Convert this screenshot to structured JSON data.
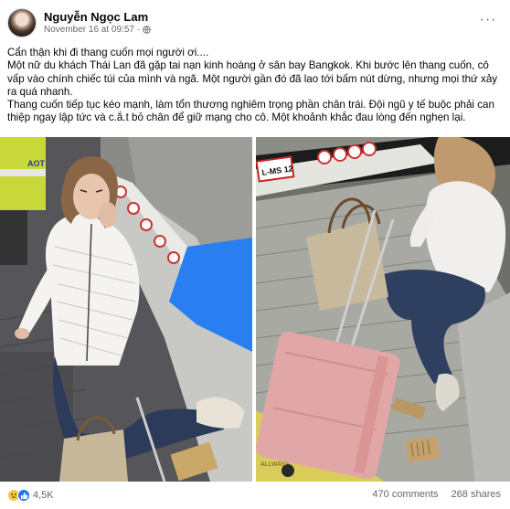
{
  "post": {
    "author": "Nguyễn Ngọc Lam",
    "date": "November 16 at 09:57",
    "separator": "·",
    "privacy_icon": "globe-icon",
    "more_label": "···",
    "text": {
      "line1": "Cẩn thận khi đi thang cuốn mọi người ơi....",
      "para2": "Một nữ du khách Thái Lan đã gặp tai nạn kinh hoàng ở sân bay Bangkok. Khi bước lên thang cuốn, cô vấp vào chính chiếc túi của mình và ngã. Một người gần đó đã lao tới bấm nút dừng, nhưng mọi thứ xảy ra quá nhanh.",
      "para3": "Thang cuốn tiếp tục kéo mạnh, làm tổn thương nghiêm trọng phần chân trái. Đội ngũ y tế buộc phải can thiệp ngay lập tức và c.ắ.t bỏ chân để giữ mạng cho cô. Một khoảnh khắc đau lòng đến nghẹn lại."
    },
    "photo_sign_text": "L-MS 12",
    "photo_vest_text": "AOT",
    "photo_trolley_text": "ALLWAYS",
    "reactions": {
      "icons": [
        "sad-react-icon",
        "like-react-icon"
      ],
      "count": "4,5K"
    },
    "comments": "470 comments",
    "shares": "268 shares"
  },
  "colors": {
    "secondary_text": "#65676b",
    "like_blue": "#1877f2",
    "sad_yellow": "#f7c53f",
    "pink_suitcase": "#e1a7a6"
  }
}
